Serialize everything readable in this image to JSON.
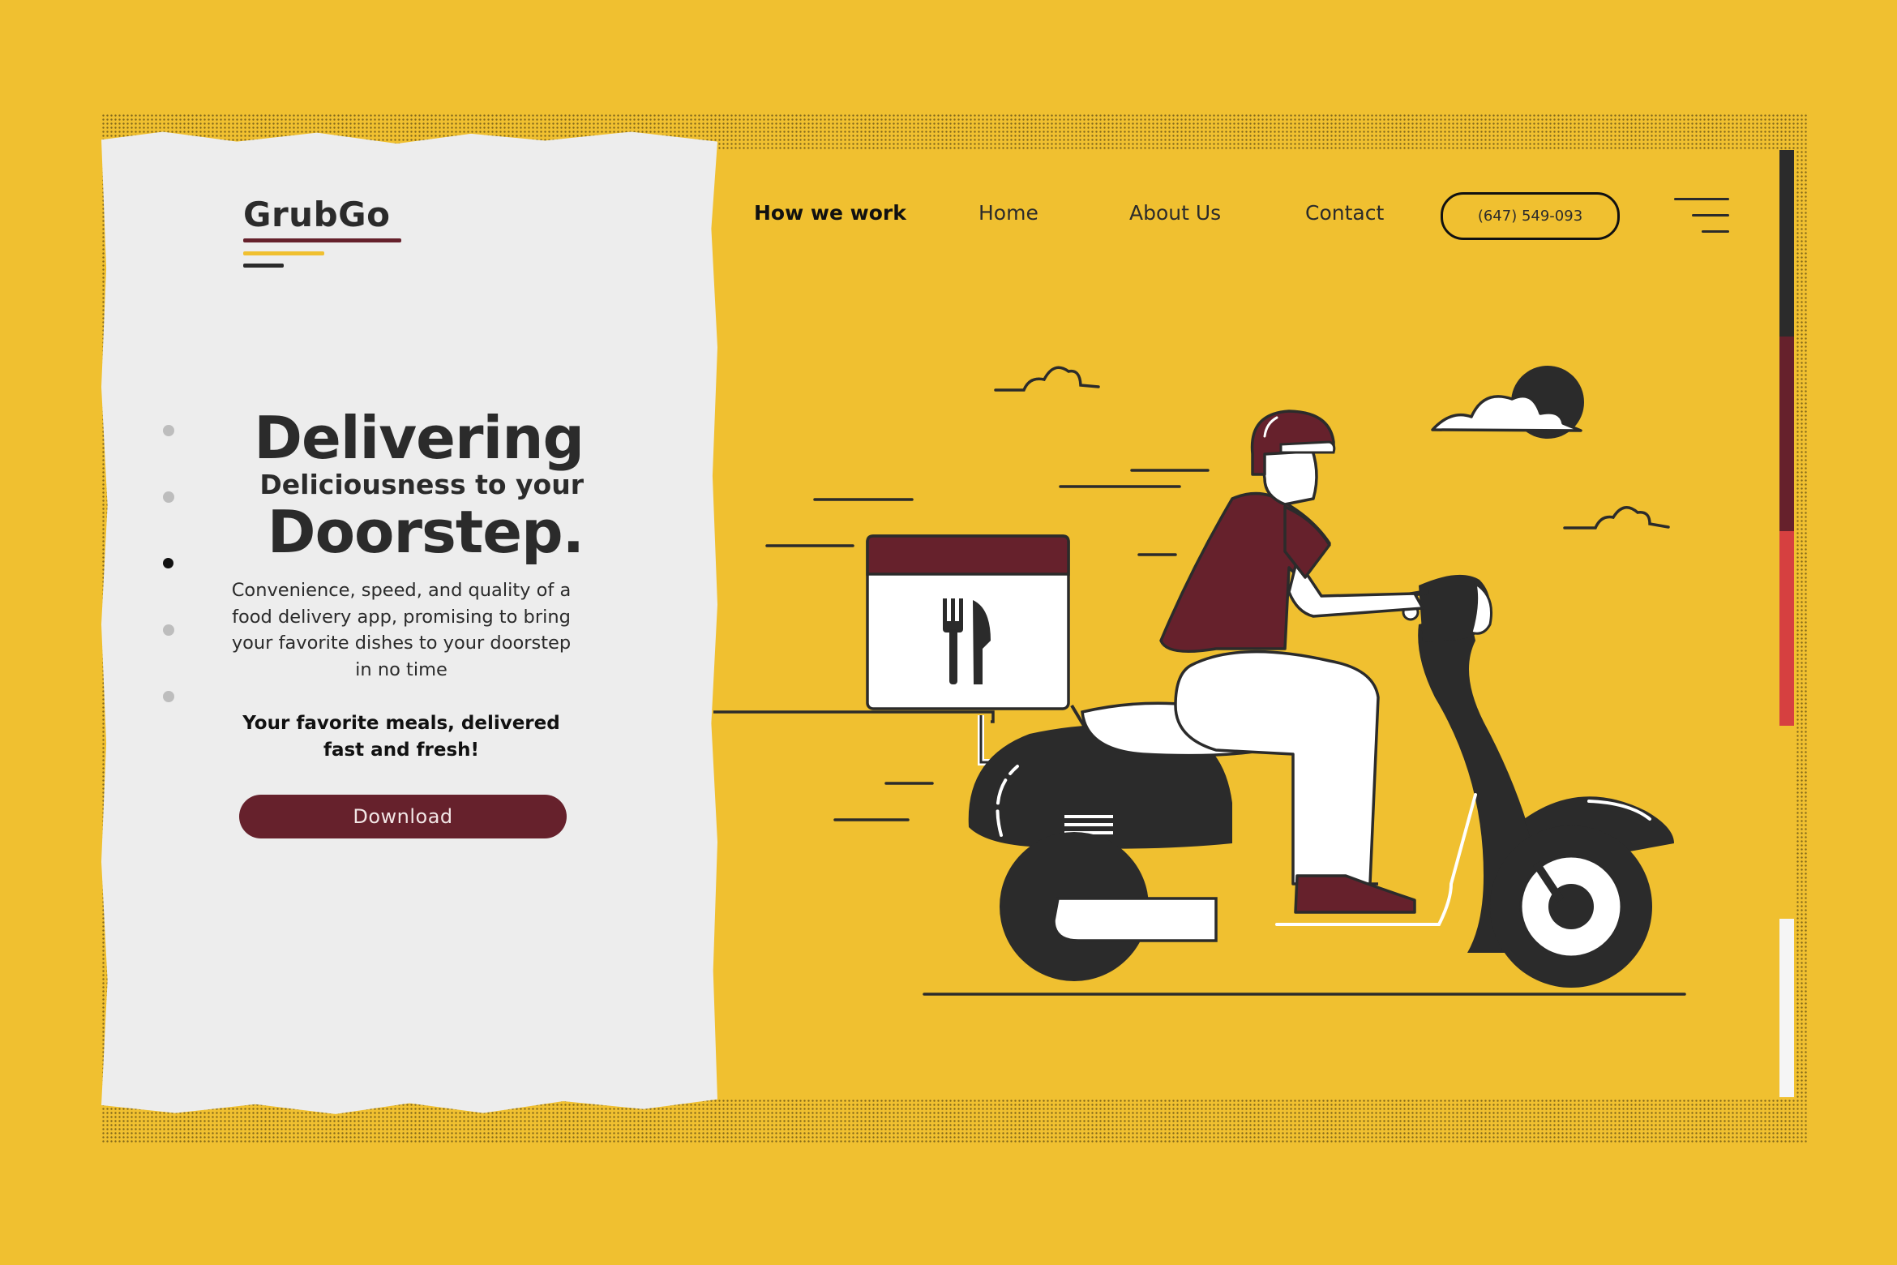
{
  "brand": {
    "name": "GrubGo"
  },
  "nav": {
    "items": [
      {
        "label": "How we work",
        "active": true
      },
      {
        "label": "Home",
        "active": false
      },
      {
        "label": "About Us",
        "active": false
      },
      {
        "label": "Contact",
        "active": false
      }
    ],
    "phone": "(647) 549-093",
    "menu_icon": "hamburger-menu-icon"
  },
  "hero": {
    "headline_line1": "Delivering",
    "headline_line2": "Deliciousness to your",
    "headline_line3": "Doorstep.",
    "description": "Convenience, speed, and quality of a food delivery app, promising to bring your favorite dishes to your doorstep in no time",
    "tagline": "Your favorite meals, delivered fast and fresh!",
    "cta_label": "Download"
  },
  "slider": {
    "count": 5,
    "active_index": 2
  },
  "colors": {
    "background": "#F0C030",
    "panel": "#EDEDED",
    "accent": "#66212C",
    "dark": "#2B2B2B",
    "red": "#D64040",
    "white": "#FFFFFF"
  },
  "illustration": {
    "subject": "delivery-rider-on-scooter",
    "icons": [
      "cloud-icon",
      "sun-icon",
      "fork-knife-icon",
      "delivery-box-icon",
      "scooter-icon",
      "helmet-icon"
    ]
  }
}
